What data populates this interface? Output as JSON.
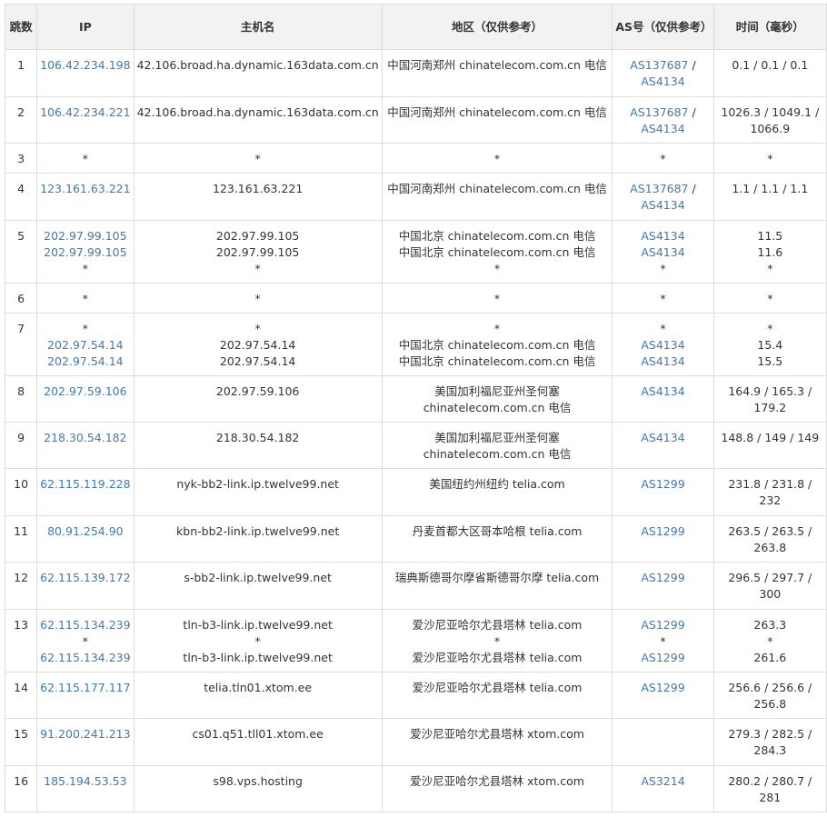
{
  "headers": {
    "hop": "跳数",
    "ip": "IP",
    "host": "主机名",
    "region": "地区（仅供参考）",
    "as": "AS号（仅供参考）",
    "time": "时间（毫秒）"
  },
  "rows": [
    {
      "hop": "1",
      "ip": [
        "106.42.234.198"
      ],
      "host": [
        "42.106.broad.ha.dynamic.163data.com.cn"
      ],
      "region": [
        "中国河南郑州 chinatelecom.com.cn 电信"
      ],
      "as": [
        [
          "AS137687",
          " / "
        ],
        [
          "AS4134",
          ""
        ]
      ],
      "as_mode": "pair",
      "time": [
        "0.1 / 0.1 / 0.1"
      ]
    },
    {
      "hop": "2",
      "ip": [
        "106.42.234.221"
      ],
      "host": [
        "42.106.broad.ha.dynamic.163data.com.cn"
      ],
      "region": [
        "中国河南郑州 chinatelecom.com.cn 电信"
      ],
      "as": [
        [
          "AS137687",
          " / "
        ],
        [
          "AS4134",
          ""
        ]
      ],
      "as_mode": "pair",
      "time": [
        "1026.3 / 1049.1 /",
        "1066.9"
      ]
    },
    {
      "hop": "3",
      "ip": [
        "*"
      ],
      "host": [
        "*"
      ],
      "region": [
        "*"
      ],
      "as": [
        [
          "*",
          ""
        ]
      ],
      "as_mode": "lines",
      "time": [
        "*"
      ]
    },
    {
      "hop": "4",
      "ip": [
        "123.161.63.221"
      ],
      "host": [
        "123.161.63.221"
      ],
      "region": [
        "中国河南郑州 chinatelecom.com.cn 电信"
      ],
      "as": [
        [
          "AS137687",
          " / "
        ],
        [
          "AS4134",
          ""
        ]
      ],
      "as_mode": "pair",
      "time": [
        "1.1 / 1.1 / 1.1"
      ]
    },
    {
      "hop": "5",
      "ip": [
        "202.97.99.105",
        "202.97.99.105",
        "*"
      ],
      "host": [
        "202.97.99.105",
        "202.97.99.105",
        "*"
      ],
      "region": [
        "中国北京 chinatelecom.com.cn 电信",
        "中国北京 chinatelecom.com.cn 电信",
        "*"
      ],
      "as": [
        [
          "AS4134",
          ""
        ],
        [
          "AS4134",
          ""
        ],
        [
          "*",
          ""
        ]
      ],
      "as_mode": "lines",
      "time": [
        "11.5",
        "11.6",
        "*"
      ]
    },
    {
      "hop": "6",
      "ip": [
        "*"
      ],
      "host": [
        "*"
      ],
      "region": [
        "*"
      ],
      "as": [
        [
          "*",
          ""
        ]
      ],
      "as_mode": "lines",
      "time": [
        "*"
      ]
    },
    {
      "hop": "7",
      "ip": [
        "*",
        "202.97.54.14",
        "202.97.54.14"
      ],
      "host": [
        "*",
        "202.97.54.14",
        "202.97.54.14"
      ],
      "region": [
        "*",
        "中国北京 chinatelecom.com.cn 电信",
        "中国北京 chinatelecom.com.cn 电信"
      ],
      "as": [
        [
          "*",
          ""
        ],
        [
          "AS4134",
          ""
        ],
        [
          "AS4134",
          ""
        ]
      ],
      "as_mode": "lines",
      "time": [
        "*",
        "15.4",
        "15.5"
      ]
    },
    {
      "hop": "8",
      "ip": [
        "202.97.59.106"
      ],
      "host": [
        "202.97.59.106"
      ],
      "region": [
        "美国加利福尼亚州圣何塞",
        "chinatelecom.com.cn 电信"
      ],
      "as": [
        [
          "AS4134",
          ""
        ]
      ],
      "as_mode": "lines",
      "time": [
        "164.9 / 165.3 /",
        "179.2"
      ]
    },
    {
      "hop": "9",
      "ip": [
        "218.30.54.182"
      ],
      "host": [
        "218.30.54.182"
      ],
      "region": [
        "美国加利福尼亚州圣何塞",
        "chinatelecom.com.cn 电信"
      ],
      "as": [
        [
          "AS4134",
          ""
        ]
      ],
      "as_mode": "lines",
      "time": [
        "148.8 / 149 / 149"
      ]
    },
    {
      "hop": "10",
      "ip": [
        "62.115.119.228"
      ],
      "host": [
        "nyk-bb2-link.ip.twelve99.net"
      ],
      "region": [
        "美国纽约州纽约 telia.com"
      ],
      "as": [
        [
          "AS1299",
          ""
        ]
      ],
      "as_mode": "lines",
      "time": [
        "231.8 / 231.8 /",
        "232"
      ]
    },
    {
      "hop": "11",
      "ip": [
        "80.91.254.90"
      ],
      "host": [
        "kbn-bb2-link.ip.twelve99.net"
      ],
      "region": [
        "丹麦首都大区哥本哈根 telia.com"
      ],
      "as": [
        [
          "AS1299",
          ""
        ]
      ],
      "as_mode": "lines",
      "time": [
        "263.5 / 263.5 /",
        "263.8"
      ]
    },
    {
      "hop": "12",
      "ip": [
        "62.115.139.172"
      ],
      "host": [
        "s-bb2-link.ip.twelve99.net"
      ],
      "region": [
        "瑞典斯德哥尔摩省斯德哥尔摩 telia.com"
      ],
      "as": [
        [
          "AS1299",
          ""
        ]
      ],
      "as_mode": "lines",
      "time": [
        "296.5 / 297.7 /",
        "300"
      ]
    },
    {
      "hop": "13",
      "ip": [
        "62.115.134.239",
        "*",
        "62.115.134.239"
      ],
      "host": [
        "tln-b3-link.ip.twelve99.net",
        "*",
        "tln-b3-link.ip.twelve99.net"
      ],
      "region": [
        "爱沙尼亚哈尔尤县塔林 telia.com",
        "*",
        "爱沙尼亚哈尔尤县塔林 telia.com"
      ],
      "as": [
        [
          "AS1299",
          ""
        ],
        [
          "*",
          ""
        ],
        [
          "AS1299",
          ""
        ]
      ],
      "as_mode": "lines",
      "time": [
        "263.3",
        "*",
        "261.6"
      ]
    },
    {
      "hop": "14",
      "ip": [
        "62.115.177.117"
      ],
      "host": [
        "telia.tln01.xtom.ee"
      ],
      "region": [
        "爱沙尼亚哈尔尤县塔林 telia.com"
      ],
      "as": [
        [
          "AS1299",
          ""
        ]
      ],
      "as_mode": "lines",
      "time": [
        "256.6 / 256.6 /",
        "256.8"
      ]
    },
    {
      "hop": "15",
      "ip": [
        "91.200.241.213"
      ],
      "host": [
        "cs01.q51.tll01.xtom.ee"
      ],
      "region": [
        "爱沙尼亚哈尔尤县塔林 xtom.com"
      ],
      "as": [],
      "as_mode": "lines",
      "time": [
        "279.3 / 282.5 /",
        "284.3"
      ]
    },
    {
      "hop": "16",
      "ip": [
        "185.194.53.53"
      ],
      "host": [
        "s98.vps.hosting"
      ],
      "region": [
        "爱沙尼亚哈尔尤县塔林 xtom.com"
      ],
      "as": [
        [
          "AS3214",
          ""
        ]
      ],
      "as_mode": "lines",
      "time": [
        "280.2 / 280.7 /",
        "281"
      ]
    }
  ],
  "colors": {
    "link": "#3d7ab8",
    "header_bg": "#f2f2f2",
    "border": "#dddddd",
    "text": "#333333"
  }
}
